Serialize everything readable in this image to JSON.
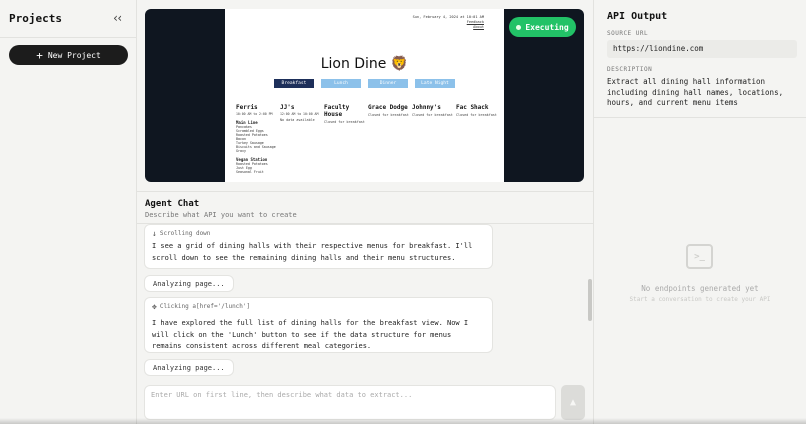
{
  "sidebar": {
    "title": "Projects",
    "collapse_icon": "double-chevron-left-icon",
    "new_project_label": "New Project"
  },
  "preview": {
    "site": {
      "date_text": "Sun, February 4, 2024 at 10:01 AM",
      "feedback_link": "Feedback",
      "about_link": "About",
      "title": "Lion Dine 🦁",
      "meal_tabs": [
        "Breakfast",
        "Lunch",
        "Dinner",
        "Late Night"
      ],
      "active_meal": "Breakfast",
      "halls": [
        {
          "name": "Ferris",
          "hours": "10:00 AM to 2:00 PM",
          "status": "",
          "station": "Main Line",
          "items": [
            "Pancakes",
            "Scrambled Eggs",
            "Roasted Potatoes",
            "Bacon",
            "Turkey Sausage",
            "Biscuits and Sausage Gravy"
          ],
          "station2": "Vegan Station",
          "items2": [
            "Roasted Potatoes",
            "Just Egg",
            "Seasonal Fruit"
          ]
        },
        {
          "name": "JJ's",
          "hours": "12:00 AM to 10:00 AM",
          "status": "No data available",
          "station": "",
          "items": [],
          "station2": "",
          "items2": []
        },
        {
          "name": "Faculty House",
          "hours": "",
          "status": "Closed for breakfast",
          "station": "",
          "items": [],
          "station2": "",
          "items2": []
        },
        {
          "name": "Grace Dodge",
          "hours": "",
          "status": "Closed for breakfast",
          "station": "",
          "items": [],
          "station2": "",
          "items2": []
        },
        {
          "name": "Johnny's",
          "hours": "",
          "status": "Closed for breakfast",
          "station": "",
          "items": [],
          "station2": "",
          "items2": []
        },
        {
          "name": "Fac Shack",
          "hours": "",
          "status": "Closed for breakfast",
          "station": "",
          "items": [],
          "station2": "",
          "items2": []
        }
      ]
    },
    "status_label": "Executing",
    "status_color": "#22c267"
  },
  "chat": {
    "title": "Agent Chat",
    "subtitle": "Describe what API you want to create",
    "messages": [
      {
        "action_icon": "arrow-down-icon",
        "action": "Scrolling down",
        "text": "I see a grid of dining halls with their respective menus for breakfast. I'll scroll down to see the remaining dining halls and their menu structures."
      },
      {
        "pill": "Analyzing page..."
      },
      {
        "action_icon": "cursor-click-icon",
        "action": "Clicking a[href='/lunch']",
        "text": "I have explored the full list of dining halls for the breakfast view. Now I will click on the 'Lunch' button to see if the data structure for menus remains consistent across different meal categories."
      },
      {
        "pill": "Analyzing page..."
      }
    ],
    "input_placeholder": "Enter URL on first line, then describe what data to extract...",
    "send_icon": "send-icon"
  },
  "api_output": {
    "title": "API Output",
    "source_url_label": "SOURCE URL",
    "source_url": "https://liondine.com",
    "description_label": "DESCRIPTION",
    "description": "Extract all dining hall information including dining hall names, locations, hours, and current menu items",
    "empty_icon": "terminal-icon",
    "empty_title": "No endpoints generated yet",
    "empty_subtitle": "Start a conversation to create your API"
  }
}
